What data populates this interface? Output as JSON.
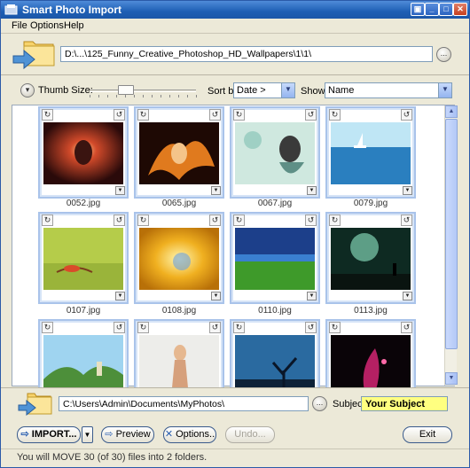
{
  "window": {
    "title": "Smart Photo Import"
  },
  "menu": {
    "file": "File",
    "options": "Options",
    "help": "Help"
  },
  "source": {
    "path": "D:\\...\\125_Funny_Creative_Photoshop_HD_Wallpapers\\1\\1\\",
    "browse_label": "..."
  },
  "toolbar": {
    "thumb_size_label": "Thumb Size:",
    "sort_by_label": "Sort by",
    "sort_value": "Date >",
    "show_label": "Show",
    "show_value": "Name"
  },
  "thumbnails": [
    {
      "name": "0052.jpg",
      "icon": "woman-glow-image"
    },
    {
      "name": "0065.jpg",
      "icon": "woman-fire-image"
    },
    {
      "name": "0067.jpg",
      "icon": "woman-headphones-image"
    },
    {
      "name": "0079.jpg",
      "icon": "underwater-boat-image"
    },
    {
      "name": "0107.jpg",
      "icon": "chameleon-image"
    },
    {
      "name": "0108.jpg",
      "icon": "abstract-burst-image"
    },
    {
      "name": "0110.jpg",
      "icon": "field-landscape-image"
    },
    {
      "name": "0113.jpg",
      "icon": "planet-figure-image"
    },
    {
      "name": "",
      "icon": "fantasy-castle-image"
    },
    {
      "name": "",
      "icon": "woman-white-image"
    },
    {
      "name": "",
      "icon": "tree-silhouette-image"
    },
    {
      "name": "",
      "icon": "pink-particles-image"
    }
  ],
  "destination": {
    "path": "C:\\Users\\Admin\\Documents\\MyPhotos\\",
    "browse_label": "...",
    "subject_label": "Subject",
    "subject_value": "Your Subject"
  },
  "buttons": {
    "import": "IMPORT...",
    "preview": "Preview",
    "options": "Options..",
    "undo": "Undo...",
    "exit": "Exit"
  },
  "status": {
    "text": "You will MOVE 30 (of 30) files into 2 folders."
  },
  "colors": {
    "title_bar": "#1e5fb4",
    "subject_highlight": "#ffff80",
    "thumb_border": "#a9c3ea"
  }
}
